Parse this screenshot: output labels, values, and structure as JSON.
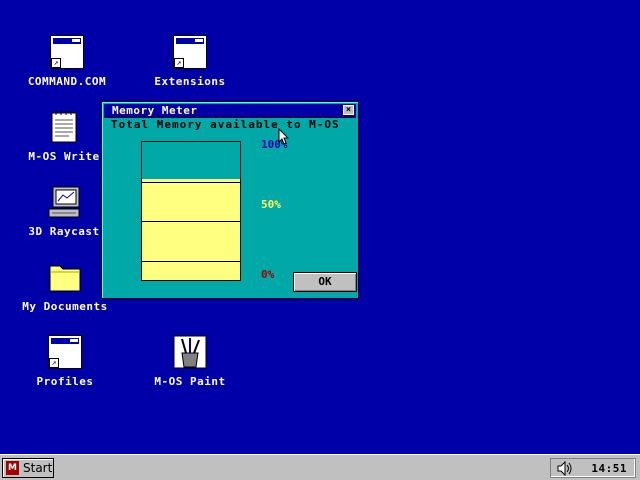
{
  "desktop": {
    "icons": [
      {
        "label": "COMMAND.COM",
        "icon": "window-shortcut-icon"
      },
      {
        "label": "Extensions",
        "icon": "window-shortcut-icon"
      },
      {
        "label": "M-OS Write",
        "icon": "notepad-icon"
      },
      {
        "label": "3D Raycast",
        "icon": "computer-icon"
      },
      {
        "label": "My Documents",
        "icon": "folder-icon"
      },
      {
        "label": "Profiles",
        "icon": "window-shortcut-icon"
      },
      {
        "label": "M-OS Paint",
        "icon": "paint-brushes-icon"
      }
    ]
  },
  "dialog": {
    "title": "Memory Meter",
    "close_label": "×",
    "subtitle": "Total Memory available to M-OS",
    "meter": {
      "available_fraction": 0.73,
      "marks": [
        {
          "label": "100%",
          "color": "#0000a8"
        },
        {
          "label": "50%",
          "color": "#ffff55"
        },
        {
          "label": "0%",
          "color": "#a80000"
        }
      ],
      "fill_color": "#ffff80"
    },
    "ok_label": "OK"
  },
  "taskbar": {
    "start_label": "Start",
    "start_logo": "M",
    "clock": "14:51",
    "tray_icon": "speaker-icon"
  },
  "colors": {
    "desktop": "#0000a8",
    "dialog_bg": "#00a8a8",
    "titlebar": "#0000a8",
    "taskbar": "#c0c0c0"
  }
}
